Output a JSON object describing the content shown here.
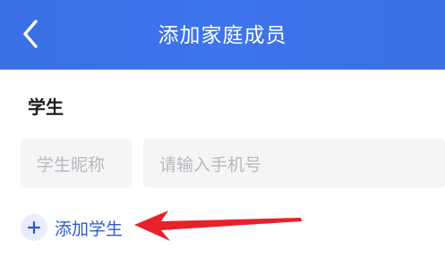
{
  "header": {
    "title": "添加家庭成员",
    "back_icon": "chevron-left-icon"
  },
  "section": {
    "title": "学生"
  },
  "form": {
    "nickname_placeholder": "学生昵称",
    "phone_placeholder": "请输入手机号"
  },
  "add_student": {
    "icon": "plus-icon",
    "label": "添加学生"
  },
  "annotation": {
    "arrow_color": "#e8202a"
  },
  "colors": {
    "header_blue": "#3a6fe4",
    "link_blue": "#2d59d4"
  }
}
